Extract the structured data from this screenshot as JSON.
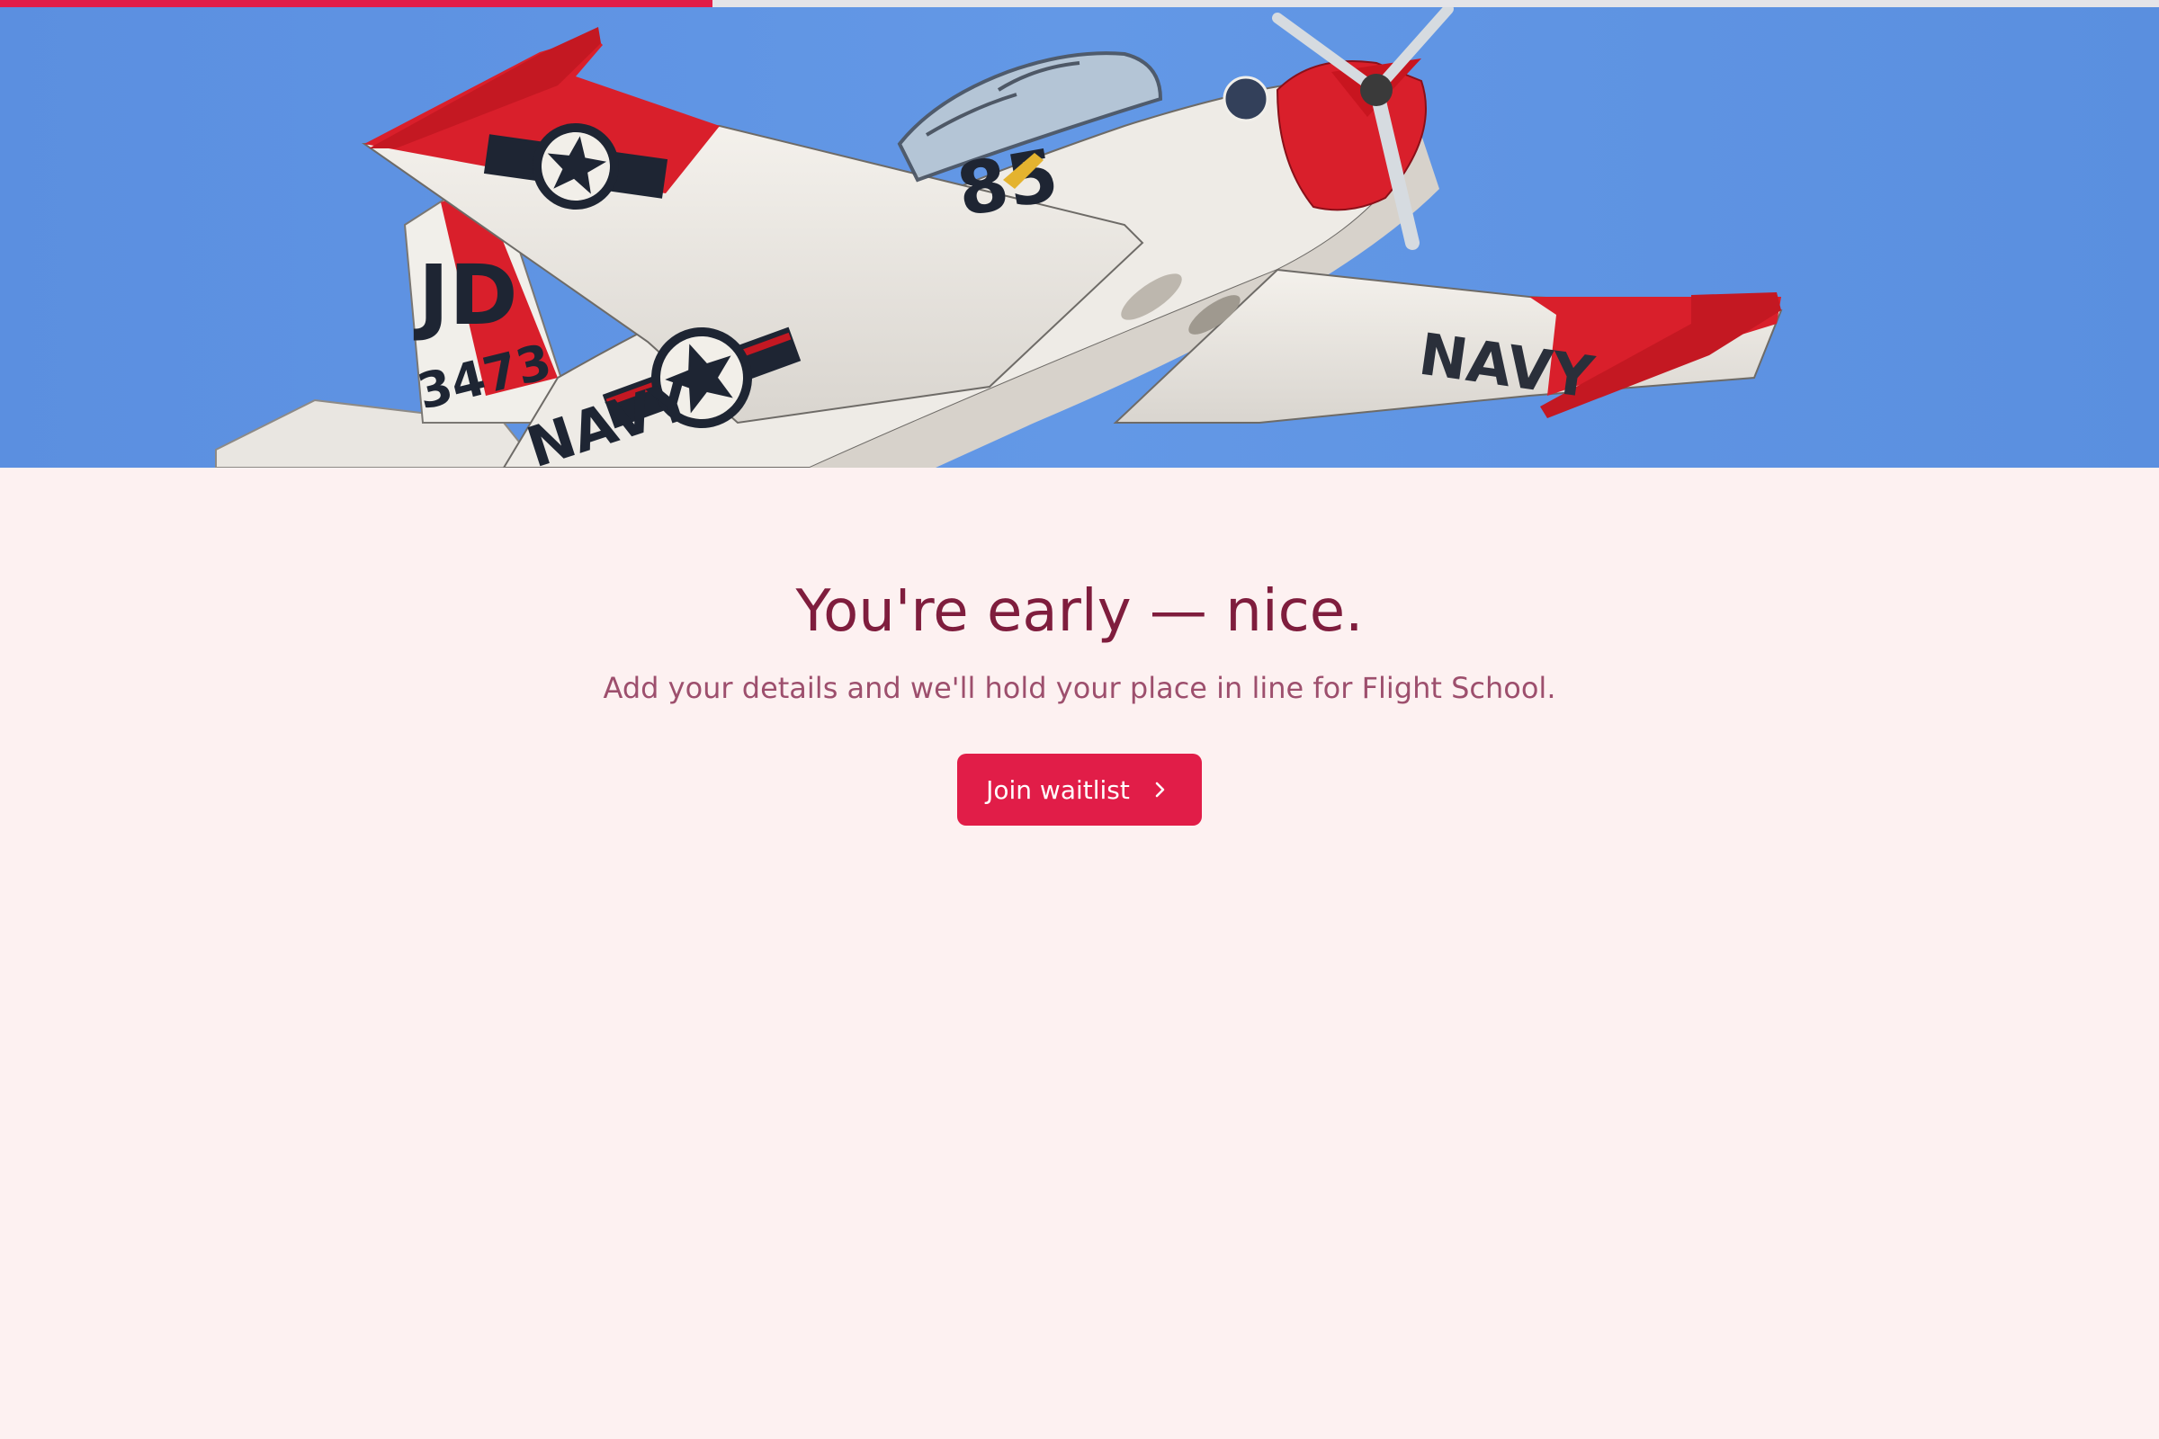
{
  "progress": {
    "fraction": 0.33,
    "fill_color": "#e11d48",
    "track_color": "#e4e4e8"
  },
  "hero": {
    "image": "navy-trainer-airplane-in-flight",
    "sky_color": "#5f94e4",
    "tail_code": "JD",
    "tail_number": "3473",
    "fuselage_number": "85",
    "fuselage_marking": "NAVY",
    "wing_marking": "NAVY"
  },
  "main": {
    "headline": "You're early — nice.",
    "subtitle": "Add your details and we'll hold your place in line for Flight School.",
    "cta_label": "Join waitlist",
    "cta_icon": "chevron-right-icon"
  },
  "colors": {
    "background": "#fdf1f1",
    "accent": "#e11d48",
    "headline": "#7f1d3d",
    "subtitle": "#9d4f6d"
  }
}
